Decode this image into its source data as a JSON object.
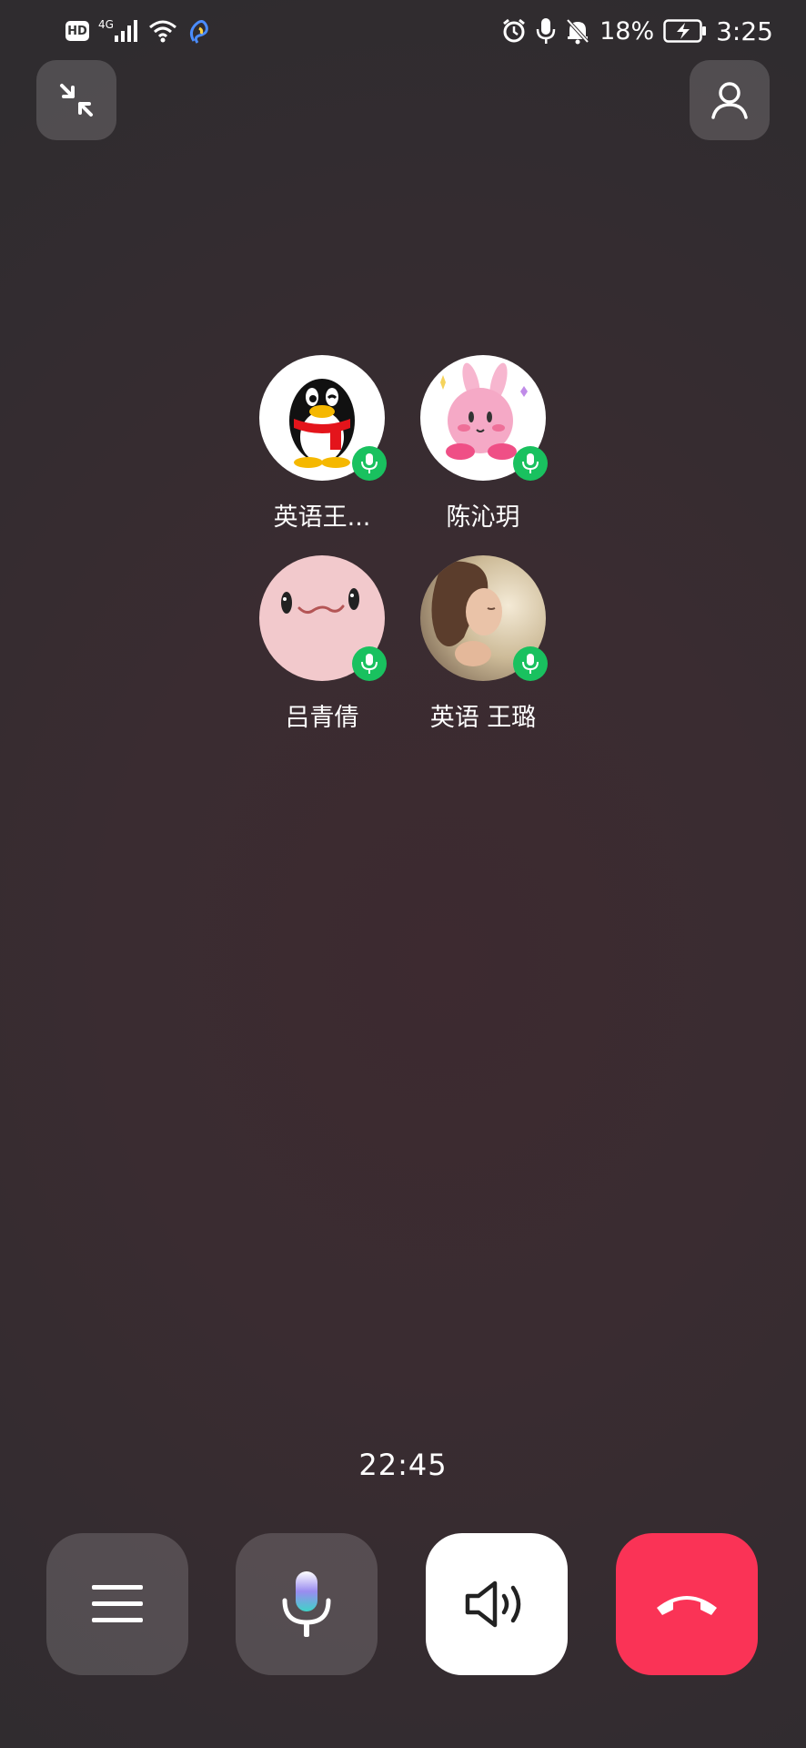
{
  "status_bar": {
    "hd_label": "HD",
    "network_label": "4G",
    "battery_percent": "18%",
    "time": "3:25"
  },
  "participants": [
    {
      "name": "英语王...",
      "avatar": "qq-penguin",
      "mic": "mic-on"
    },
    {
      "name": "陈沁玥",
      "avatar": "pink-kirby-bunny",
      "mic": "mic-on"
    },
    {
      "name": "吕青倩",
      "avatar": "pink-blob-face",
      "mic": "mic-on"
    },
    {
      "name": "英语 王璐",
      "avatar": "girl-photo",
      "mic": "mic-on"
    }
  ],
  "call": {
    "duration": "22:45"
  },
  "controls": {
    "menu": "menu-icon",
    "mic": "microphone-icon",
    "speaker": "speaker-icon",
    "hangup": "hangup-icon"
  },
  "colors": {
    "mic_badge": "#19c15f",
    "hangup": "#fa3356"
  }
}
